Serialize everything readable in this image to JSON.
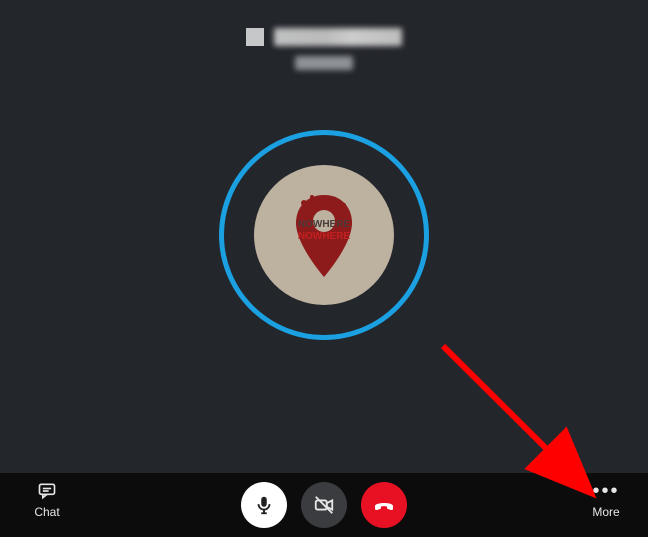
{
  "header": {
    "contact_name": "███████",
    "status_text": "██████"
  },
  "avatar": {
    "text_line1": "NOWHERE",
    "text_line2": "NOWHERE"
  },
  "controls": {
    "chat_label": "Chat",
    "more_label": "More",
    "mic_name": "microphone-button",
    "camera_name": "camera-off-button",
    "end_name": "end-call-button"
  },
  "colors": {
    "ring": "#1ba1e2",
    "end_call": "#e81123",
    "stage_bg": "#23262b"
  }
}
